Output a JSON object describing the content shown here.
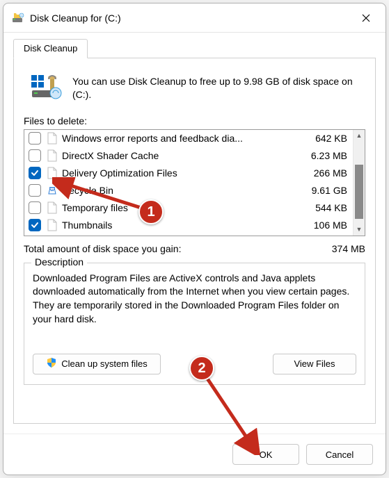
{
  "window": {
    "title": "Disk Cleanup for  (C:)"
  },
  "tabs": [
    "Disk Cleanup"
  ],
  "intro": "You can use Disk Cleanup to free up to 9.98 GB of disk space on  (C:).",
  "filesToDeleteLabel": "Files to delete:",
  "items": [
    {
      "checked": false,
      "icon": "file",
      "name": "Windows error reports and feedback dia...",
      "size": "642 KB"
    },
    {
      "checked": false,
      "icon": "file",
      "name": "DirectX Shader Cache",
      "size": "6.23 MB"
    },
    {
      "checked": true,
      "icon": "file",
      "name": "Delivery Optimization Files",
      "size": "266 MB"
    },
    {
      "checked": false,
      "icon": "recycle",
      "name": "Recycle Bin",
      "size": "9.61 GB"
    },
    {
      "checked": false,
      "icon": "file",
      "name": "Temporary files",
      "size": "544 KB"
    },
    {
      "checked": true,
      "icon": "file",
      "name": "Thumbnails",
      "size": "106 MB"
    }
  ],
  "totalLabel": "Total amount of disk space you gain:",
  "totalValue": "374 MB",
  "description": {
    "legend": "Description",
    "text": "Downloaded Program Files are ActiveX controls and Java applets downloaded automatically from the Internet when you view certain pages. They are temporarily stored in the Downloaded Program Files folder on your hard disk."
  },
  "buttons": {
    "cleanSystem": "Clean up system files",
    "viewFiles": "View Files",
    "ok": "OK",
    "cancel": "Cancel"
  },
  "annotations": {
    "b1": "1",
    "b2": "2"
  }
}
